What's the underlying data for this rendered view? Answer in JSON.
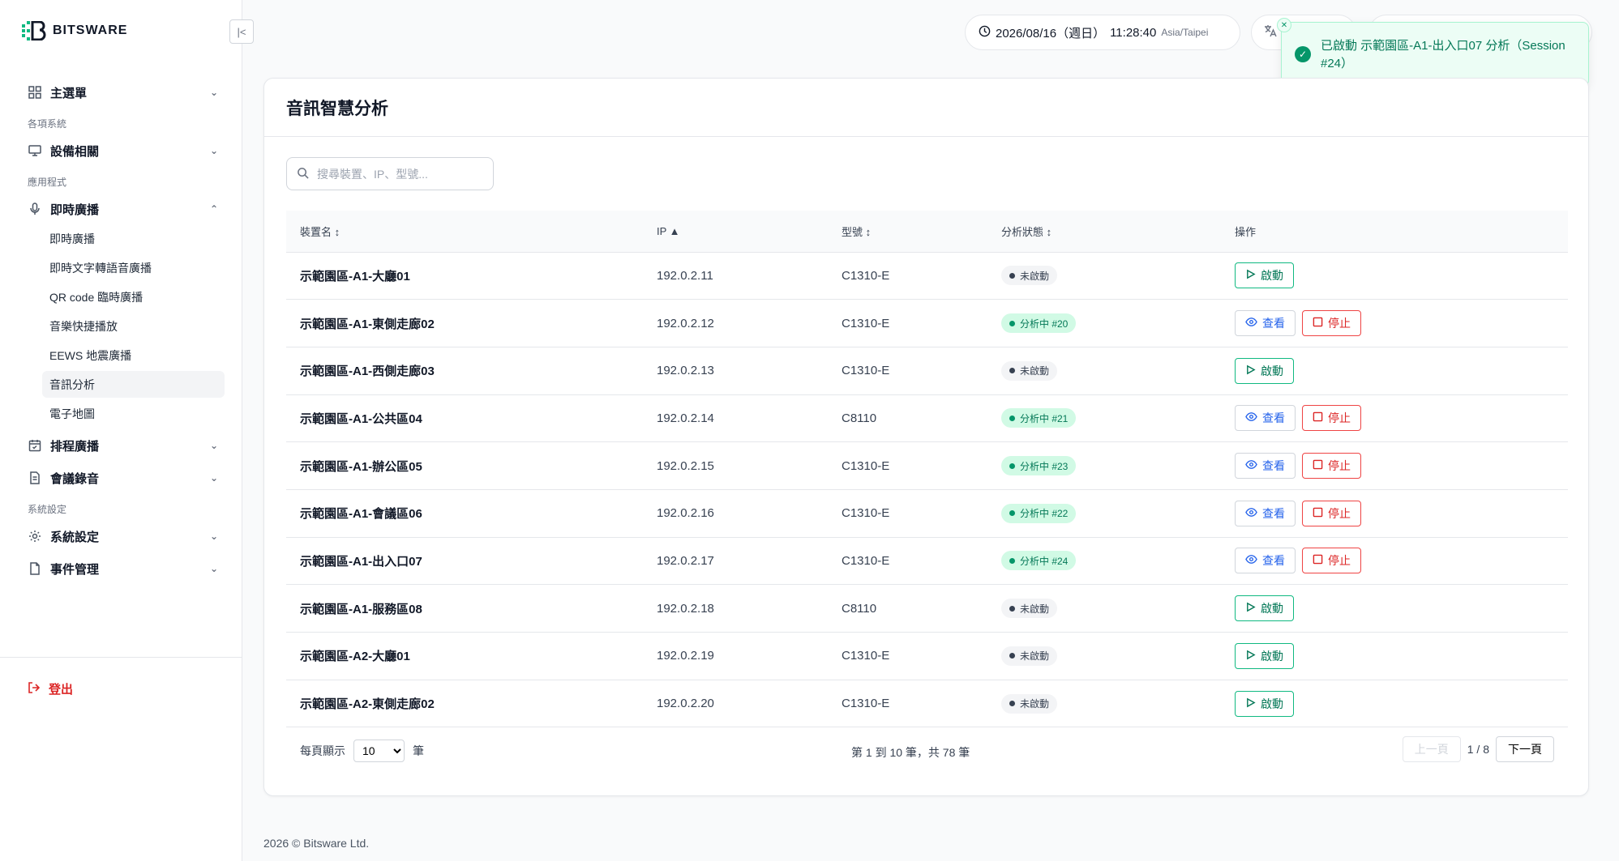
{
  "brand": {
    "name": "BITSWARE",
    "accent": "#10b981"
  },
  "sidebar": {
    "main_menu": "主選單",
    "section_systems": "各項系統",
    "devices": "設備相關",
    "section_apps": "應用程式",
    "live_broadcast": "即時廣播",
    "live_sub": [
      "即時廣播",
      "即時文字轉語音廣播",
      "QR code 臨時廣播",
      "音樂快捷播放",
      "EEWS 地震廣播",
      "音訊分析",
      "電子地圖"
    ],
    "schedule": "排程廣播",
    "meeting": "會議錄音",
    "section_settings": "系統設定",
    "system_settings": "系統設定",
    "events": "事件管理",
    "logout": "登出"
  },
  "header": {
    "date": "2026/08/16（週日）",
    "time": "11:28:40",
    "timezone": "Asia/Taipei"
  },
  "toast": {
    "message": "已啟動 示範園區-A1-出入口07 分析（Session #24）"
  },
  "page": {
    "title": "音訊智慧分析",
    "search_placeholder": "搜尋裝置、IP、型號..."
  },
  "table": {
    "headers": {
      "name": "裝置名 ↕",
      "ip": "IP ▲",
      "model": "型號 ↕",
      "status": "分析狀態 ↕",
      "actions": "操作"
    },
    "rows": [
      {
        "name": "示範園區-A1-大廳01",
        "ip": "192.0.2.11",
        "model": "C1310-E",
        "status": "未啟動",
        "active": false
      },
      {
        "name": "示範園區-A1-東側走廊02",
        "ip": "192.0.2.12",
        "model": "C1310-E",
        "status": "分析中 #20",
        "active": true
      },
      {
        "name": "示範園區-A1-西側走廊03",
        "ip": "192.0.2.13",
        "model": "C1310-E",
        "status": "未啟動",
        "active": false
      },
      {
        "name": "示範園區-A1-公共區04",
        "ip": "192.0.2.14",
        "model": "C8110",
        "status": "分析中 #21",
        "active": true
      },
      {
        "name": "示範園區-A1-辦公區05",
        "ip": "192.0.2.15",
        "model": "C1310-E",
        "status": "分析中 #23",
        "active": true
      },
      {
        "name": "示範園區-A1-會議區06",
        "ip": "192.0.2.16",
        "model": "C1310-E",
        "status": "分析中 #22",
        "active": true
      },
      {
        "name": "示範園區-A1-出入口07",
        "ip": "192.0.2.17",
        "model": "C1310-E",
        "status": "分析中 #24",
        "active": true
      },
      {
        "name": "示範園區-A1-服務區08",
        "ip": "192.0.2.18",
        "model": "C8110",
        "status": "未啟動",
        "active": false
      },
      {
        "name": "示範園區-A2-大廳01",
        "ip": "192.0.2.19",
        "model": "C1310-E",
        "status": "未啟動",
        "active": false
      },
      {
        "name": "示範園區-A2-東側走廊02",
        "ip": "192.0.2.20",
        "model": "C1310-E",
        "status": "未啟動",
        "active": false
      }
    ],
    "actions": {
      "start": "啟動",
      "view": "查看",
      "stop": "停止"
    }
  },
  "pagination": {
    "per_page_label": "每頁顯示",
    "per_page_value": "10",
    "per_page_unit": "筆",
    "range": "第 1 到 10 筆，共 78 筆",
    "prev": "上一頁",
    "page_indicator": "1 / 8",
    "next": "下一頁"
  },
  "footer": {
    "copyright": "2026 © Bitsware Ltd."
  }
}
